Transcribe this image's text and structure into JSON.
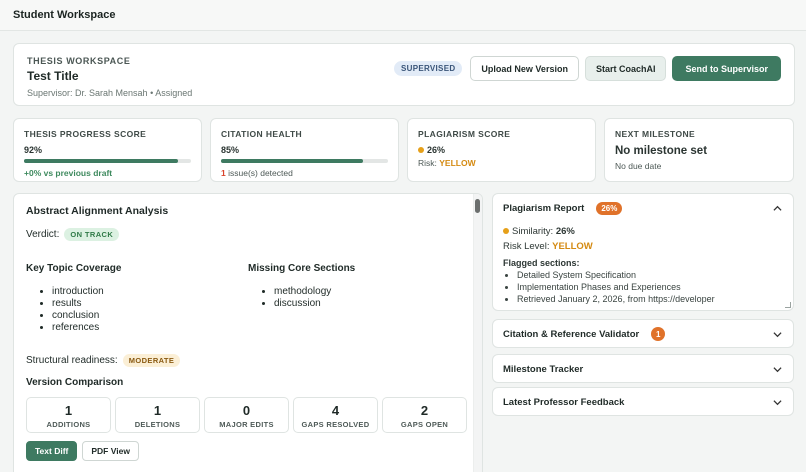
{
  "app": {
    "title": "Student Workspace"
  },
  "header": {
    "eyebrow": "THESIS WORKSPACE",
    "title": "Test Title",
    "supervisor": "Supervisor: Dr. Sarah Mensah",
    "status": "Assigned",
    "badge": "SUPERVISED",
    "upload_label": "Upload New Version",
    "coach_label": "Start CoachAI",
    "send_label": "Send to Supervisor"
  },
  "metrics": {
    "progress": {
      "label": "THESIS PROGRESS SCORE",
      "value": "92%",
      "fraction": 0.92,
      "note": "+0% vs previous draft"
    },
    "citation": {
      "label": "CITATION HEALTH",
      "value": "85%",
      "fraction": 0.85,
      "issue_count": "1",
      "issue_text": " issue(s) detected"
    },
    "plagiarism": {
      "label": "PLAGIARISM SCORE",
      "value": "26%",
      "risk_label": "Risk: ",
      "risk": "YELLOW"
    },
    "milestone": {
      "label": "NEXT MILESTONE",
      "value": "No milestone set",
      "due": "No due date"
    }
  },
  "abstract": {
    "title": "Abstract Alignment Analysis",
    "verdict_label": "Verdict:",
    "verdict": "ON TRACK",
    "coverage_title": "Key Topic Coverage",
    "coverage": [
      "introduction",
      "results",
      "conclusion",
      "references"
    ],
    "missing_title": "Missing Core Sections",
    "missing": [
      "methodology",
      "discussion"
    ],
    "readiness_label": "Structural readiness:",
    "readiness": "MODERATE"
  },
  "version": {
    "title": "Version Comparison",
    "stats": [
      {
        "n": "1",
        "l": "ADDITIONS"
      },
      {
        "n": "1",
        "l": "DELETIONS"
      },
      {
        "n": "0",
        "l": "MAJOR EDITS"
      },
      {
        "n": "4",
        "l": "GAPS RESOLVED"
      },
      {
        "n": "2",
        "l": "GAPS OPEN"
      }
    ],
    "tab_text": "Text Diff",
    "tab_pdf": "PDF View"
  },
  "plagiarism_report": {
    "title": "Plagiarism Report",
    "badge": "26%",
    "similarity_label": "Similarity: ",
    "similarity": "26%",
    "risk_label": "Risk Level: ",
    "risk": "YELLOW",
    "flagged_title": "Flagged sections:",
    "flagged": [
      "Detailed System Specification",
      "Implementation Phases and Experiences",
      "Retrieved January 2, 2026, from https://developer"
    ]
  },
  "accordions": {
    "citation": {
      "title": "Citation & Reference Validator",
      "badge": "1"
    },
    "milestone": {
      "title": "Milestone Tracker"
    },
    "feedback": {
      "title": "Latest Professor Feedback"
    }
  },
  "colors": {
    "accent": "#3e7a61",
    "warning": "#e0722a",
    "yellow": "#d48a12",
    "danger": "#d9432b"
  }
}
